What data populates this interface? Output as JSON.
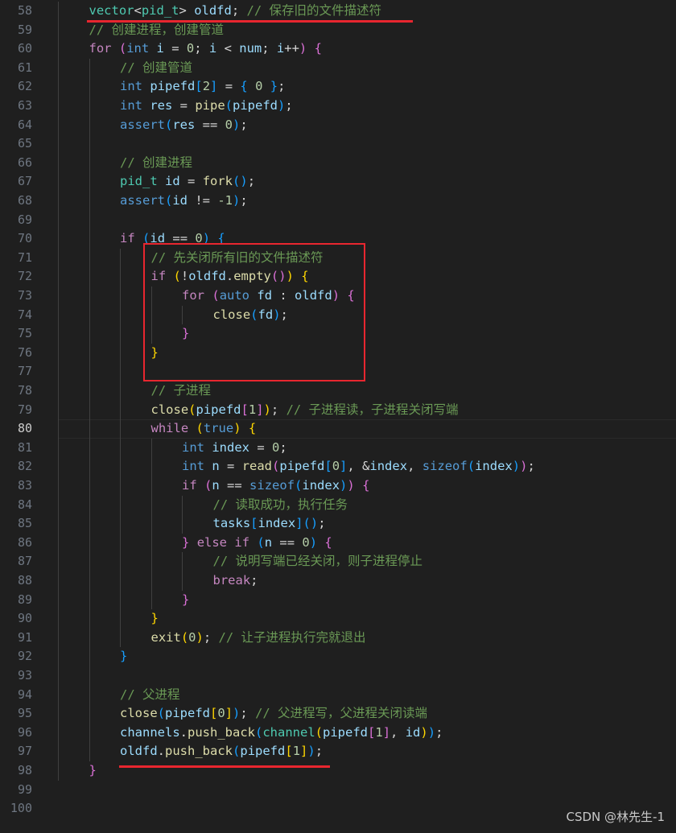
{
  "editor": {
    "current_line": 80,
    "lines": [
      {
        "n": "58",
        "indent": 1,
        "tokens": [
          [
            "vector",
            "type"
          ],
          [
            "<",
            "pl"
          ],
          [
            "pid_t",
            "type"
          ],
          [
            "> ",
            "pl"
          ],
          [
            "oldfd",
            "var"
          ],
          [
            "; ",
            "pl"
          ],
          [
            "// 保存旧的文件描述符",
            "cm"
          ]
        ]
      },
      {
        "n": "59",
        "indent": 1,
        "tokens": [
          [
            "// 创建进程，创建管道",
            "cm"
          ]
        ]
      },
      {
        "n": "60",
        "indent": 1,
        "tokens": [
          [
            "for",
            "ctl"
          ],
          [
            " ",
            "pl"
          ],
          [
            "(",
            "p2"
          ],
          [
            "int",
            "kw"
          ],
          [
            " ",
            "pl"
          ],
          [
            "i",
            "var"
          ],
          [
            " = ",
            "pl"
          ],
          [
            "0",
            "num"
          ],
          [
            "; ",
            "pl"
          ],
          [
            "i",
            "var"
          ],
          [
            " < ",
            "pl"
          ],
          [
            "num",
            "var"
          ],
          [
            "; ",
            "pl"
          ],
          [
            "i",
            "var"
          ],
          [
            "++",
            "pl"
          ],
          [
            ")",
            "p2"
          ],
          [
            " ",
            "pl"
          ],
          [
            "{",
            "p2"
          ]
        ]
      },
      {
        "n": "61",
        "indent": 2,
        "tokens": [
          [
            "// 创建管道",
            "cm"
          ]
        ]
      },
      {
        "n": "62",
        "indent": 2,
        "tokens": [
          [
            "int",
            "kw"
          ],
          [
            " ",
            "pl"
          ],
          [
            "pipefd",
            "var"
          ],
          [
            "[",
            "p3"
          ],
          [
            "2",
            "num"
          ],
          [
            "]",
            "p3"
          ],
          [
            " = ",
            "pl"
          ],
          [
            "{",
            "p3"
          ],
          [
            " ",
            "pl"
          ],
          [
            "0",
            "num"
          ],
          [
            " ",
            "pl"
          ],
          [
            "}",
            "p3"
          ],
          [
            ";",
            "pl"
          ]
        ]
      },
      {
        "n": "63",
        "indent": 2,
        "tokens": [
          [
            "int",
            "kw"
          ],
          [
            " ",
            "pl"
          ],
          [
            "res",
            "var"
          ],
          [
            " = ",
            "pl"
          ],
          [
            "pipe",
            "fn"
          ],
          [
            "(",
            "p3"
          ],
          [
            "pipefd",
            "var"
          ],
          [
            ")",
            "p3"
          ],
          [
            ";",
            "pl"
          ]
        ]
      },
      {
        "n": "64",
        "indent": 2,
        "tokens": [
          [
            "assert",
            "kw"
          ],
          [
            "(",
            "p3"
          ],
          [
            "res",
            "var"
          ],
          [
            " == ",
            "pl"
          ],
          [
            "0",
            "num"
          ],
          [
            ")",
            "p3"
          ],
          [
            ";",
            "pl"
          ]
        ]
      },
      {
        "n": "65",
        "indent": 2,
        "tokens": []
      },
      {
        "n": "66",
        "indent": 2,
        "tokens": [
          [
            "// 创建进程",
            "cm"
          ]
        ]
      },
      {
        "n": "67",
        "indent": 2,
        "tokens": [
          [
            "pid_t",
            "type"
          ],
          [
            " ",
            "pl"
          ],
          [
            "id",
            "var"
          ],
          [
            " = ",
            "pl"
          ],
          [
            "fork",
            "fn"
          ],
          [
            "()",
            "p3"
          ],
          [
            ";",
            "pl"
          ]
        ]
      },
      {
        "n": "68",
        "indent": 2,
        "tokens": [
          [
            "assert",
            "kw"
          ],
          [
            "(",
            "p3"
          ],
          [
            "id",
            "var"
          ],
          [
            " != ",
            "pl"
          ],
          [
            "-1",
            "num"
          ],
          [
            ")",
            "p3"
          ],
          [
            ";",
            "pl"
          ]
        ]
      },
      {
        "n": "69",
        "indent": 2,
        "tokens": []
      },
      {
        "n": "70",
        "indent": 2,
        "tokens": [
          [
            "if",
            "ctl"
          ],
          [
            " ",
            "pl"
          ],
          [
            "(",
            "p3"
          ],
          [
            "id",
            "var"
          ],
          [
            " == ",
            "pl"
          ],
          [
            "0",
            "num"
          ],
          [
            ")",
            "p3"
          ],
          [
            " ",
            "pl"
          ],
          [
            "{",
            "p3"
          ]
        ]
      },
      {
        "n": "71",
        "indent": 3,
        "tokens": [
          [
            "// 先关闭所有旧的文件描述符",
            "cm"
          ]
        ]
      },
      {
        "n": "72",
        "indent": 3,
        "tokens": [
          [
            "if",
            "ctl"
          ],
          [
            " ",
            "pl"
          ],
          [
            "(",
            "p1"
          ],
          [
            "!",
            "pl"
          ],
          [
            "oldfd",
            "var"
          ],
          [
            ".",
            "pl"
          ],
          [
            "empty",
            "fn"
          ],
          [
            "()",
            "p2"
          ],
          [
            ")",
            "p1"
          ],
          [
            " ",
            "pl"
          ],
          [
            "{",
            "p1"
          ]
        ]
      },
      {
        "n": "73",
        "indent": 4,
        "tokens": [
          [
            "for",
            "ctl"
          ],
          [
            " ",
            "pl"
          ],
          [
            "(",
            "p2"
          ],
          [
            "auto",
            "kw"
          ],
          [
            " ",
            "pl"
          ],
          [
            "fd",
            "var"
          ],
          [
            " : ",
            "pl"
          ],
          [
            "oldfd",
            "var"
          ],
          [
            ")",
            "p2"
          ],
          [
            " ",
            "pl"
          ],
          [
            "{",
            "p2"
          ]
        ]
      },
      {
        "n": "74",
        "indent": 5,
        "tokens": [
          [
            "close",
            "fn"
          ],
          [
            "(",
            "p3"
          ],
          [
            "fd",
            "var"
          ],
          [
            ")",
            "p3"
          ],
          [
            ";",
            "pl"
          ]
        ]
      },
      {
        "n": "75",
        "indent": 4,
        "tokens": [
          [
            "}",
            "p2"
          ]
        ]
      },
      {
        "n": "76",
        "indent": 3,
        "tokens": [
          [
            "}",
            "p1"
          ]
        ]
      },
      {
        "n": "77",
        "indent": 3,
        "tokens": []
      },
      {
        "n": "78",
        "indent": 3,
        "tokens": [
          [
            "// 子进程",
            "cm"
          ]
        ]
      },
      {
        "n": "79",
        "indent": 3,
        "tokens": [
          [
            "close",
            "fn"
          ],
          [
            "(",
            "p1"
          ],
          [
            "pipefd",
            "var"
          ],
          [
            "[",
            "p2"
          ],
          [
            "1",
            "num"
          ],
          [
            "]",
            "p2"
          ],
          [
            ")",
            "p1"
          ],
          [
            "; ",
            "pl"
          ],
          [
            "// 子进程读，子进程关闭写端",
            "cm"
          ]
        ]
      },
      {
        "n": "80",
        "indent": 3,
        "tokens": [
          [
            "while",
            "ctl"
          ],
          [
            " ",
            "pl"
          ],
          [
            "(",
            "p1"
          ],
          [
            "true",
            "kw"
          ],
          [
            ")",
            "p1"
          ],
          [
            " ",
            "pl"
          ],
          [
            "{",
            "p1"
          ]
        ]
      },
      {
        "n": "81",
        "indent": 4,
        "tokens": [
          [
            "int",
            "kw"
          ],
          [
            " ",
            "pl"
          ],
          [
            "index",
            "var"
          ],
          [
            " = ",
            "pl"
          ],
          [
            "0",
            "num"
          ],
          [
            ";",
            "pl"
          ]
        ]
      },
      {
        "n": "82",
        "indent": 4,
        "tokens": [
          [
            "int",
            "kw"
          ],
          [
            " ",
            "pl"
          ],
          [
            "n",
            "var"
          ],
          [
            " = ",
            "pl"
          ],
          [
            "read",
            "fn"
          ],
          [
            "(",
            "p2"
          ],
          [
            "pipefd",
            "var"
          ],
          [
            "[",
            "p3"
          ],
          [
            "0",
            "num"
          ],
          [
            "]",
            "p3"
          ],
          [
            ", &",
            "pl"
          ],
          [
            "index",
            "var"
          ],
          [
            ", ",
            "pl"
          ],
          [
            "sizeof",
            "kw"
          ],
          [
            "(",
            "p3"
          ],
          [
            "index",
            "var"
          ],
          [
            ")",
            "p3"
          ],
          [
            ")",
            "p2"
          ],
          [
            ";",
            "pl"
          ]
        ]
      },
      {
        "n": "83",
        "indent": 4,
        "tokens": [
          [
            "if",
            "ctl"
          ],
          [
            " ",
            "pl"
          ],
          [
            "(",
            "p2"
          ],
          [
            "n",
            "var"
          ],
          [
            " == ",
            "pl"
          ],
          [
            "sizeof",
            "kw"
          ],
          [
            "(",
            "p3"
          ],
          [
            "index",
            "var"
          ],
          [
            ")",
            "p3"
          ],
          [
            ")",
            "p2"
          ],
          [
            " ",
            "pl"
          ],
          [
            "{",
            "p2"
          ]
        ]
      },
      {
        "n": "84",
        "indent": 5,
        "tokens": [
          [
            "// 读取成功，执行任务",
            "cm"
          ]
        ]
      },
      {
        "n": "85",
        "indent": 5,
        "tokens": [
          [
            "tasks",
            "var"
          ],
          [
            "[",
            "p3"
          ],
          [
            "index",
            "var"
          ],
          [
            "]",
            "p3"
          ],
          [
            "()",
            "p3"
          ],
          [
            ";",
            "pl"
          ]
        ]
      },
      {
        "n": "86",
        "indent": 4,
        "tokens": [
          [
            "}",
            "p2"
          ],
          [
            " ",
            "pl"
          ],
          [
            "else",
            "ctl"
          ],
          [
            " ",
            "pl"
          ],
          [
            "if",
            "ctl"
          ],
          [
            " ",
            "pl"
          ],
          [
            "(",
            "p3"
          ],
          [
            "n",
            "var"
          ],
          [
            " == ",
            "pl"
          ],
          [
            "0",
            "num"
          ],
          [
            ")",
            "p3"
          ],
          [
            " ",
            "pl"
          ],
          [
            "{",
            "p2"
          ]
        ]
      },
      {
        "n": "87",
        "indent": 5,
        "tokens": [
          [
            "// 说明写端已经关闭，则子进程停止",
            "cm"
          ]
        ]
      },
      {
        "n": "88",
        "indent": 5,
        "tokens": [
          [
            "break",
            "ctl"
          ],
          [
            ";",
            "pl"
          ]
        ]
      },
      {
        "n": "89",
        "indent": 4,
        "tokens": [
          [
            "}",
            "p2"
          ]
        ]
      },
      {
        "n": "90",
        "indent": 3,
        "tokens": [
          [
            "}",
            "p1"
          ]
        ]
      },
      {
        "n": "91",
        "indent": 3,
        "tokens": [
          [
            "exit",
            "fn"
          ],
          [
            "(",
            "p1"
          ],
          [
            "0",
            "num"
          ],
          [
            ")",
            "p1"
          ],
          [
            "; ",
            "pl"
          ],
          [
            "// 让子进程执行完就退出",
            "cm"
          ]
        ]
      },
      {
        "n": "92",
        "indent": 2,
        "tokens": [
          [
            "}",
            "p3"
          ]
        ]
      },
      {
        "n": "93",
        "indent": 2,
        "tokens": []
      },
      {
        "n": "94",
        "indent": 2,
        "tokens": [
          [
            "// 父进程",
            "cm"
          ]
        ]
      },
      {
        "n": "95",
        "indent": 2,
        "tokens": [
          [
            "close",
            "fn"
          ],
          [
            "(",
            "p3"
          ],
          [
            "pipefd",
            "var"
          ],
          [
            "[",
            "p1"
          ],
          [
            "0",
            "num"
          ],
          [
            "]",
            "p1"
          ],
          [
            ")",
            "p3"
          ],
          [
            "; ",
            "pl"
          ],
          [
            "// 父进程写，父进程关闭读端",
            "cm"
          ]
        ]
      },
      {
        "n": "96",
        "indent": 2,
        "tokens": [
          [
            "channels",
            "var"
          ],
          [
            ".",
            "pl"
          ],
          [
            "push_back",
            "fn"
          ],
          [
            "(",
            "p3"
          ],
          [
            "channel",
            "type"
          ],
          [
            "(",
            "p1"
          ],
          [
            "pipefd",
            "var"
          ],
          [
            "[",
            "p2"
          ],
          [
            "1",
            "num"
          ],
          [
            "]",
            "p2"
          ],
          [
            ", ",
            "pl"
          ],
          [
            "id",
            "var"
          ],
          [
            ")",
            "p1"
          ],
          [
            ")",
            "p3"
          ],
          [
            ";",
            "pl"
          ]
        ]
      },
      {
        "n": "97",
        "indent": 2,
        "tokens": [
          [
            "oldfd",
            "var"
          ],
          [
            ".",
            "pl"
          ],
          [
            "push_back",
            "fn"
          ],
          [
            "(",
            "p3"
          ],
          [
            "pipefd",
            "var"
          ],
          [
            "[",
            "p1"
          ],
          [
            "1",
            "num"
          ],
          [
            "]",
            "p1"
          ],
          [
            ")",
            "p3"
          ],
          [
            ";",
            "pl"
          ]
        ]
      },
      {
        "n": "98",
        "indent": 1,
        "tokens": [
          [
            "}",
            "p2"
          ]
        ]
      },
      {
        "n": "99",
        "indent": 0,
        "tokens": []
      },
      {
        "n": "100",
        "indent": 0,
        "tokens": []
      }
    ]
  },
  "annotations": [
    {
      "kind": "underline",
      "note": "line 58"
    },
    {
      "kind": "box",
      "note": "lines 71-77"
    },
    {
      "kind": "underline",
      "note": "line 97"
    }
  ],
  "colors": {
    "background": "#1f1f1f",
    "annotation": "#e8262f",
    "comment": "#6a9955",
    "keyword": "#569cd6",
    "control": "#c586c0",
    "type": "#4ec9b0",
    "variable": "#9cdcfe",
    "function": "#dcdcaa",
    "number": "#b5cea8"
  },
  "watermark": "CSDN @林先生-1"
}
